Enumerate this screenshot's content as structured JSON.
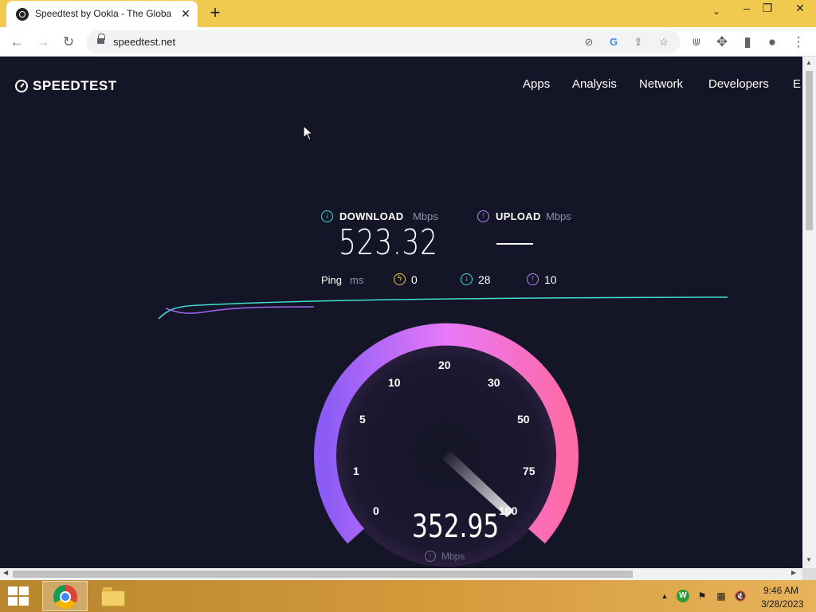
{
  "browser": {
    "tab_title": "Speedtest by Ookla - The Global",
    "url": "speedtest.net"
  },
  "site": {
    "logo_text": "SPEEDTEST",
    "nav": [
      "Apps",
      "Analysis",
      "Network",
      "Developers",
      "E"
    ]
  },
  "results": {
    "download_label": "DOWNLOAD",
    "upload_label": "UPLOAD",
    "unit": "Mbps",
    "download_value": "523.32",
    "ping_label": "Ping",
    "ping_unit": "ms",
    "ping_idle": "0",
    "ping_download": "28",
    "ping_upload": "10"
  },
  "gauge": {
    "ticks": [
      "0",
      "1",
      "5",
      "10",
      "20",
      "30",
      "50",
      "75",
      "100"
    ],
    "value": "352.95",
    "unit": "Mbps",
    "colors": {
      "start": "#8b5cf6",
      "mid": "#e879f9",
      "end": "#ff6aa5"
    }
  },
  "taskbar": {
    "time": "9:46 AM",
    "date": "3/28/2023"
  }
}
